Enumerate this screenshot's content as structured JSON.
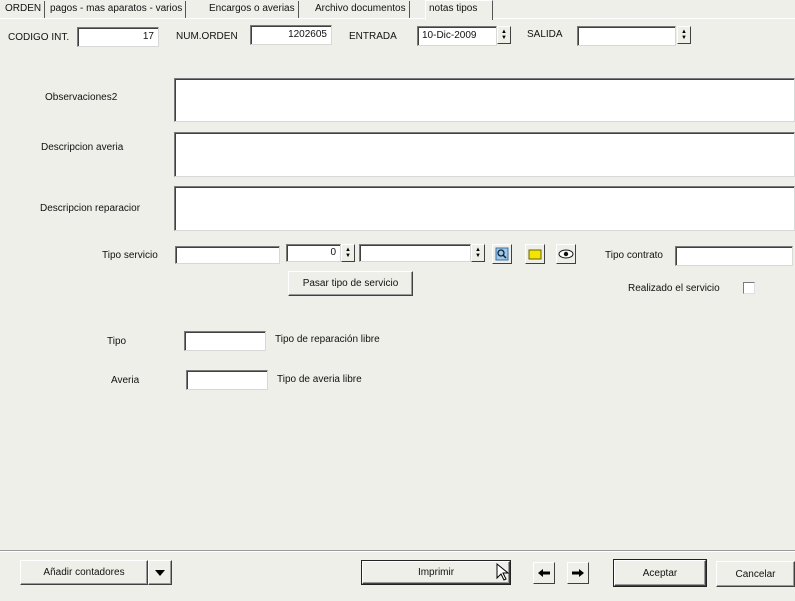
{
  "tabs": [
    {
      "label": "ORDEN"
    },
    {
      "label": "pagos - mas aparatos - varios"
    },
    {
      "label": "Encargos o averias"
    },
    {
      "label": "Archivo documentos"
    },
    {
      "label": "notas tipos"
    }
  ],
  "header": {
    "codigo_label": "CODIGO INT.",
    "codigo_value": "17",
    "numorden_label": "NUM.ORDEN",
    "numorden_value": "1202605",
    "entrada_label": "ENTRADA",
    "entrada_value": "10-Dic-2009",
    "salida_label": "SALIDA",
    "salida_value": ""
  },
  "notes": {
    "observaciones_label": "Observaciones2",
    "descripcion_averia_label": "Descripcion averia",
    "descripcion_reparacion_label": "Descripcion reparacior"
  },
  "servicio": {
    "tipo_servicio_label": "Tipo servicio",
    "tipo_servicio_value": "",
    "cantidad_value": "0",
    "servicio_select_value": "",
    "tipo_contrato_label": "Tipo contrato",
    "tipo_contrato_value": "",
    "pasar_button": "Pasar tipo de servicio",
    "realizado_label": "Realizado el servicio",
    "icons": [
      "search-icon",
      "folder-icon",
      "eye-icon"
    ]
  },
  "libre": {
    "tipo_label": "Tipo",
    "tipo_value": "",
    "tipo_libre_label": "Tipo de reparación libre",
    "averia_label": "Averia",
    "averia_value": "",
    "averia_libre_label": "Tipo de averia libre"
  },
  "footer": {
    "anadir_button": "Añadir contadores",
    "imprimir_button": "Imprimir",
    "aceptar_button": "Aceptar",
    "cancelar_button": "Cancelar"
  }
}
